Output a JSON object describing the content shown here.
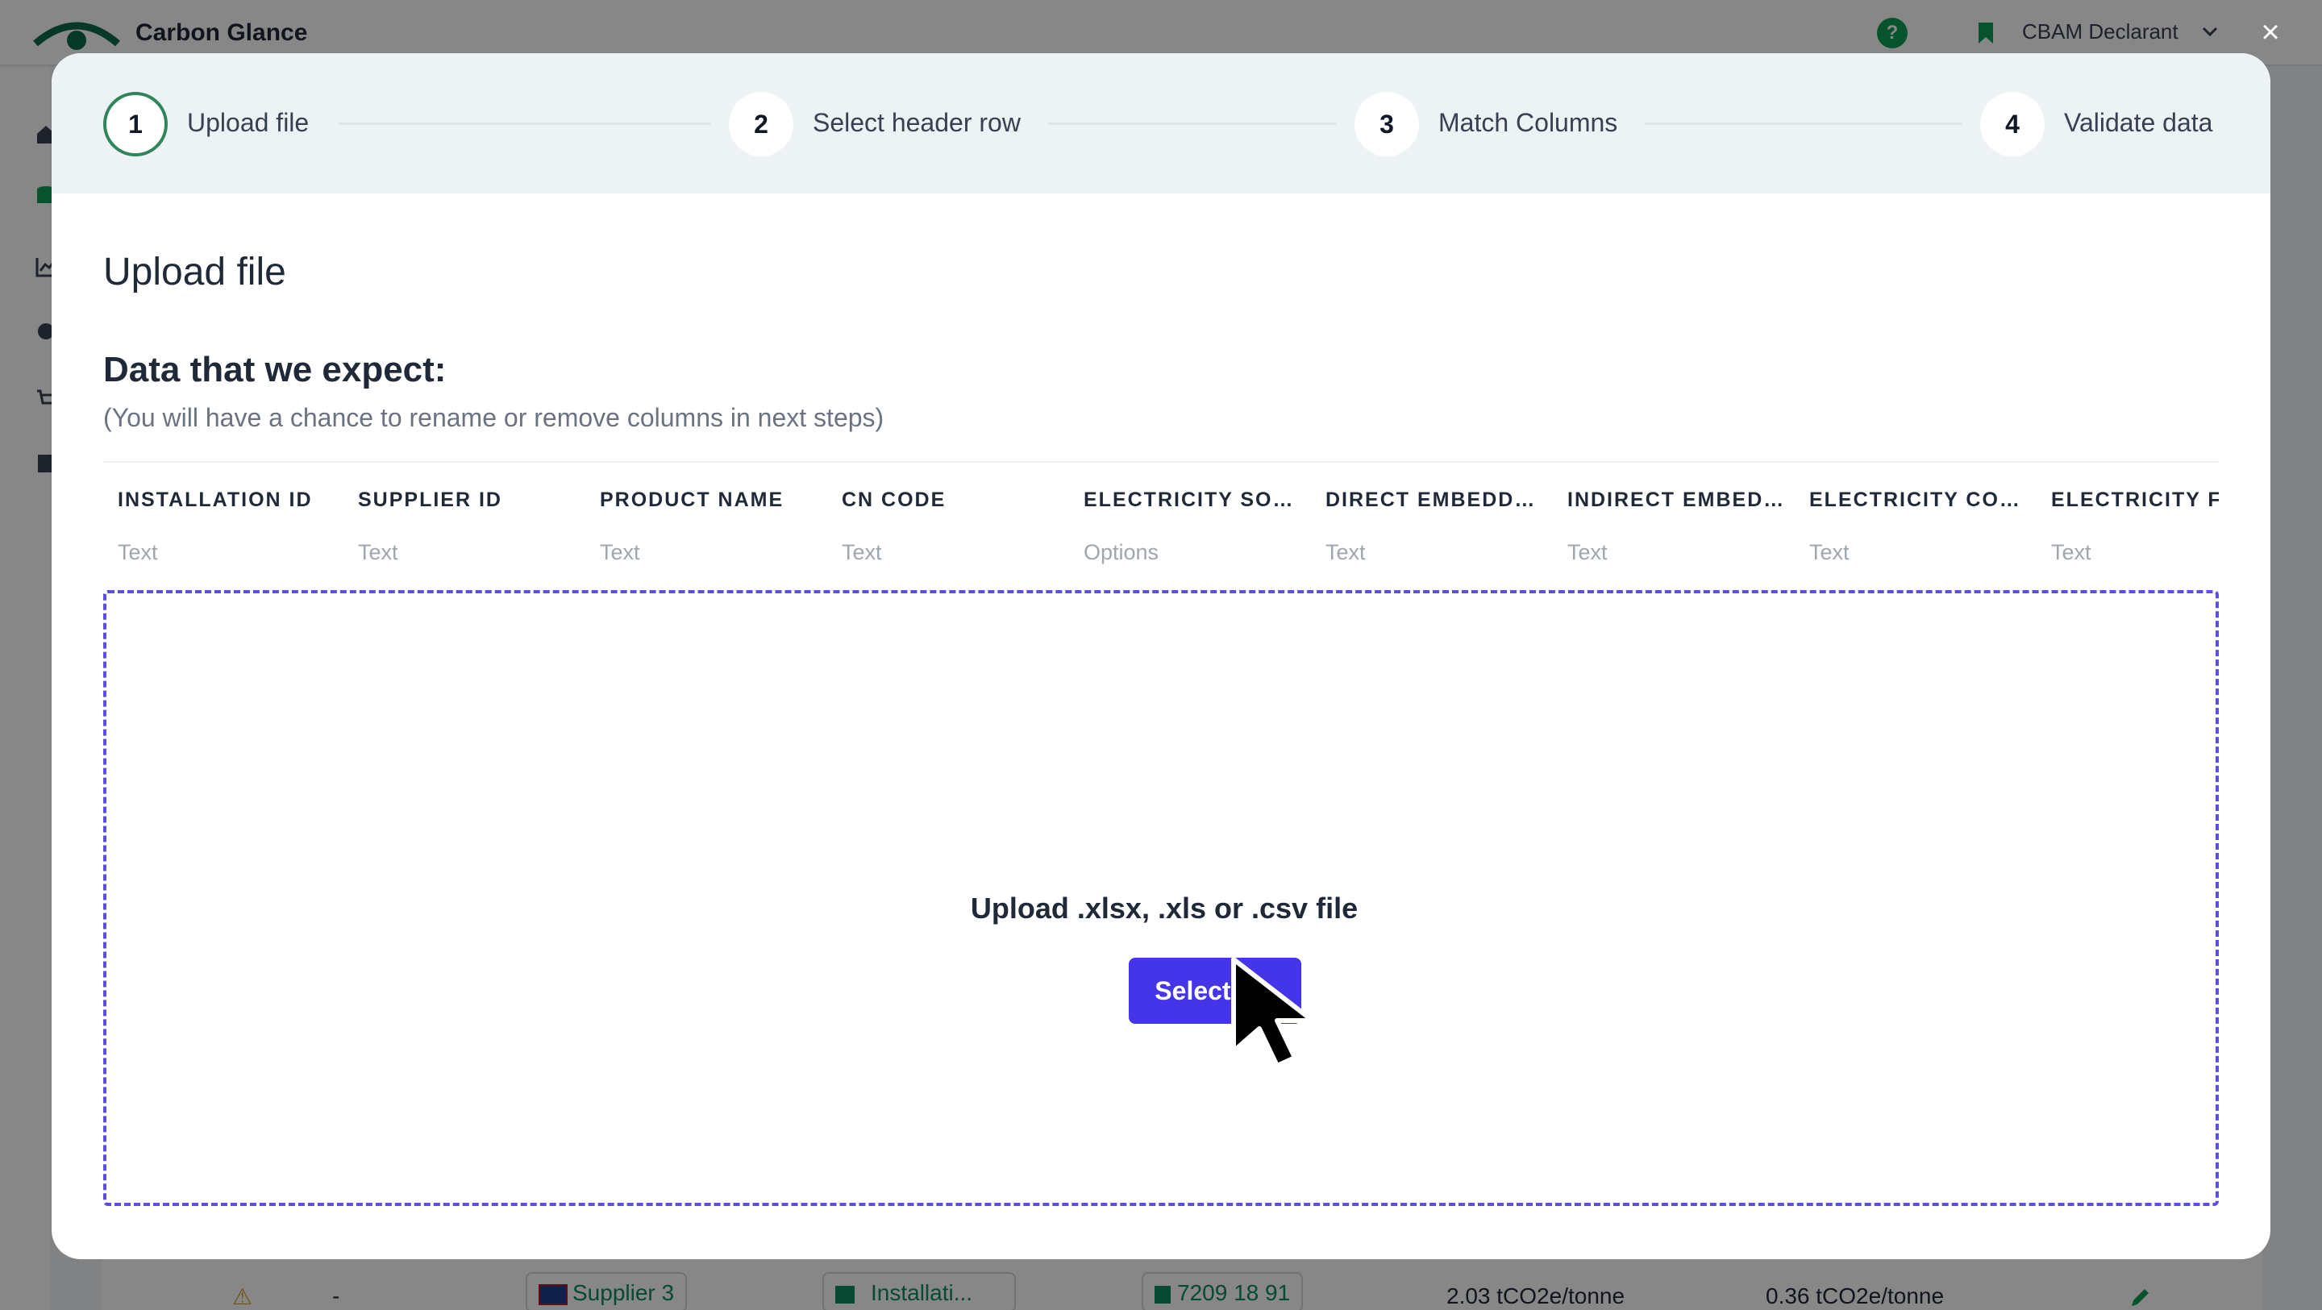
{
  "app": {
    "brand": "Carbon Glance",
    "help_glyph": "?",
    "role": "CBAM Declarant",
    "close_glyph": "×",
    "colors": {
      "accent": "#4535e8",
      "brand_green": "#0f9d58",
      "step_active": "#2f855a"
    }
  },
  "background_row": {
    "warning": "⚠",
    "dash": "-",
    "supplier": "Supplier 3",
    "installation": "Installati...",
    "cn_code": "7209 18 91",
    "direct": "2.03 tCO2e/tonne",
    "indirect": "0.36 tCO2e/tonne"
  },
  "stepper": {
    "steps": [
      {
        "number": "1",
        "label": "Upload file"
      },
      {
        "number": "2",
        "label": "Select header row"
      },
      {
        "number": "3",
        "label": "Match Columns"
      },
      {
        "number": "4",
        "label": "Validate data"
      }
    ]
  },
  "modal": {
    "title": "Upload file",
    "expect_title": "Data that we expect:",
    "expect_subtitle": "(You will have a chance to rename or remove columns in next steps)",
    "columns": [
      {
        "header": "INSTALLATION ID",
        "type": "Text"
      },
      {
        "header": "SUPPLIER ID",
        "type": "Text"
      },
      {
        "header": "PRODUCT NAME",
        "type": "Text"
      },
      {
        "header": "CN CODE",
        "type": "Text"
      },
      {
        "header": "ELECTRICITY SOU...",
        "type": "Options"
      },
      {
        "header": "DIRECT EMBEDDE...",
        "type": "Text"
      },
      {
        "header": "INDIRECT EMBEDD...",
        "type": "Text"
      },
      {
        "header": "ELECTRICITY CON...",
        "type": "Text"
      },
      {
        "header": "ELECTRICITY FA",
        "type": "Text"
      }
    ],
    "dropzone_text": "Upload .xlsx, .xls or .csv file",
    "select_button": "Select file"
  }
}
